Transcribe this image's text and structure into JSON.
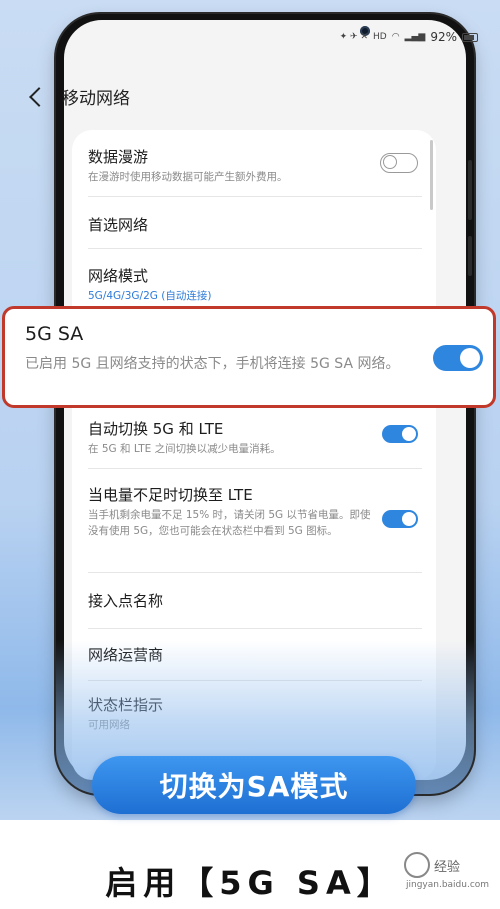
{
  "status_bar": {
    "battery_percent": "92%",
    "icons": [
      "signal-icon",
      "wifi-icon",
      "hd-icon",
      "battery-icon"
    ]
  },
  "header": {
    "title": "移动网络"
  },
  "settings": {
    "data_roaming": {
      "title": "数据漫游",
      "subtitle": "在漫游时使用移动数据可能产生额外费用。",
      "enabled": false
    },
    "preferred_network": {
      "title": "首选网络"
    },
    "network_mode": {
      "title": "网络模式",
      "value": "5G/4G/3G/2G (自动连接)"
    },
    "sa_5g": {
      "title": "5G SA",
      "subtitle": "已启用 5G 且网络支持的状态下，手机将连接 5G SA 网络。",
      "enabled": true
    },
    "auto_switch": {
      "title": "自动切换 5G 和 LTE",
      "subtitle": "在 5G 和 LTE 之间切换以减少电量消耗。",
      "enabled": true
    },
    "low_battery_switch": {
      "title": "当电量不足时切换至 LTE",
      "subtitle": "当手机剩余电量不足 15% 时，请关闭 5G 以节省电量。即使没有使用 5G，您也可能会在状态栏中看到 5G 图标。",
      "enabled": true
    },
    "apn": {
      "title": "接入点名称"
    },
    "operators": {
      "title": "网络运营商"
    },
    "status_indicator": {
      "title": "状态栏指示",
      "subtitle": "可用网络"
    }
  },
  "cta": {
    "label": "切换为SA模式"
  },
  "caption": "启用【5G SA】",
  "watermark": {
    "text": "经验",
    "url": "jingyan.baidu.com"
  },
  "colors": {
    "accent": "#2f86de",
    "highlight_border": "#c0392b",
    "link_blue": "#2d7bd8"
  }
}
